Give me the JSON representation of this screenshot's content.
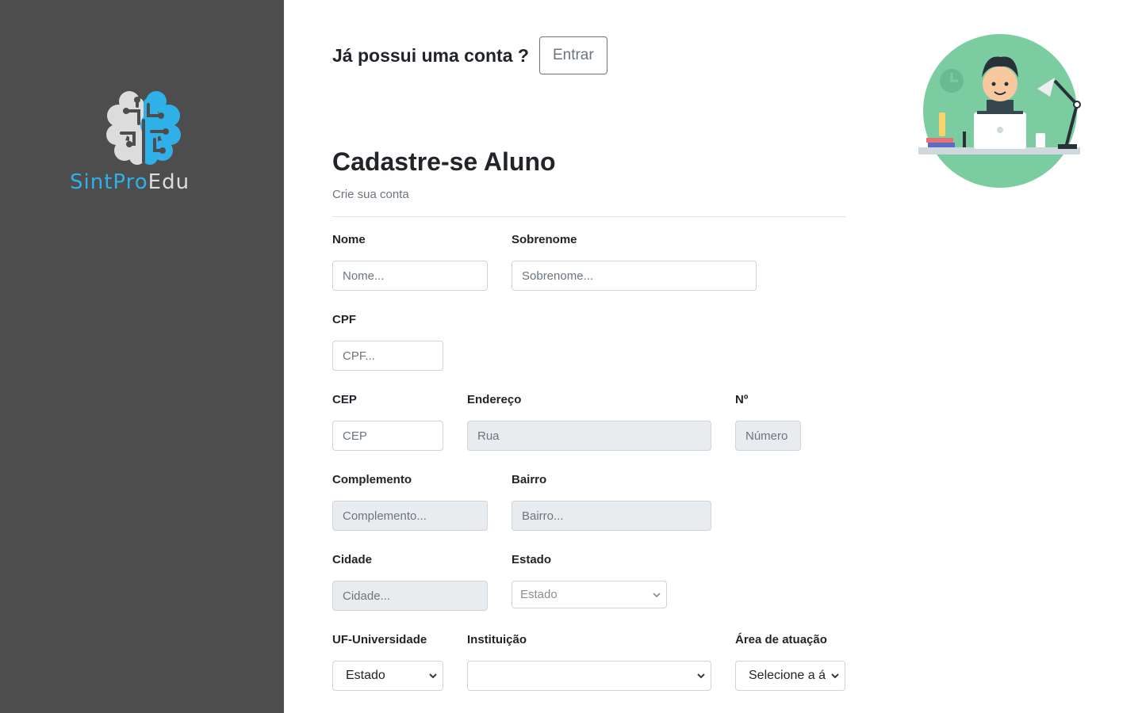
{
  "brand": {
    "name_part1": "SintPro",
    "name_part2": "Edu",
    "colors": {
      "blue": "#2fb0e8",
      "gray": "#dcdcdc",
      "sidebar": "#4d4d4d"
    }
  },
  "signin": {
    "question": "Já possui uma conta ?",
    "button": "Entrar"
  },
  "form": {
    "title": "Cadastre-se Aluno",
    "subtitle": "Crie sua conta",
    "fields": {
      "nome": {
        "label": "Nome",
        "placeholder": "Nome..."
      },
      "sobrenome": {
        "label": "Sobrenome",
        "placeholder": "Sobrenome..."
      },
      "cpf": {
        "label": "CPF",
        "placeholder": "CPF..."
      },
      "cep": {
        "label": "CEP",
        "placeholder": "CEP"
      },
      "endereco": {
        "label": "Endereço",
        "placeholder": "Rua"
      },
      "numero": {
        "label": "Nº",
        "placeholder": "Número"
      },
      "complemento": {
        "label": "Complemento",
        "placeholder": "Complemento..."
      },
      "bairro": {
        "label": "Bairro",
        "placeholder": "Bairro..."
      },
      "cidade": {
        "label": "Cidade",
        "placeholder": "Cidade..."
      },
      "estado": {
        "label": "Estado",
        "selected": "Estado"
      },
      "uf_universidade": {
        "label": "UF-Universidade",
        "selected": "Estado"
      },
      "instituicao": {
        "label": "Instituição",
        "selected": ""
      },
      "area_atuacao": {
        "label": "Área de atuação",
        "selected": "Selecione a á"
      }
    }
  }
}
